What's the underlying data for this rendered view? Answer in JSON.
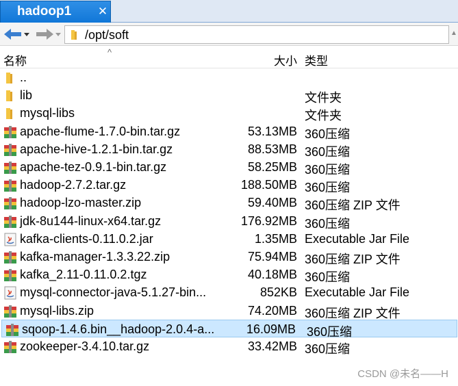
{
  "tab": {
    "title": "hadoop1",
    "close": "✕"
  },
  "address": {
    "path": "/opt/soft"
  },
  "header": {
    "name": "名称",
    "size": "大小",
    "type": "类型"
  },
  "files": [
    {
      "name": "..",
      "size": "",
      "type": "",
      "icon": "folder-icon"
    },
    {
      "name": "lib",
      "size": "",
      "type": "文件夹",
      "icon": "folder-icon"
    },
    {
      "name": "mysql-libs",
      "size": "",
      "type": "文件夹",
      "icon": "folder-icon"
    },
    {
      "name": "apache-flume-1.7.0-bin.tar.gz",
      "size": "53.13MB",
      "type": "360压缩",
      "icon": "archive-icon"
    },
    {
      "name": "apache-hive-1.2.1-bin.tar.gz",
      "size": "88.53MB",
      "type": "360压缩",
      "icon": "archive-icon"
    },
    {
      "name": "apache-tez-0.9.1-bin.tar.gz",
      "size": "58.25MB",
      "type": "360压缩",
      "icon": "archive-icon"
    },
    {
      "name": "hadoop-2.7.2.tar.gz",
      "size": "188.50MB",
      "type": "360压缩",
      "icon": "archive-icon"
    },
    {
      "name": "hadoop-lzo-master.zip",
      "size": "59.40MB",
      "type": "360压缩 ZIP 文件",
      "icon": "archive-icon"
    },
    {
      "name": "jdk-8u144-linux-x64.tar.gz",
      "size": "176.92MB",
      "type": "360压缩",
      "icon": "archive-icon"
    },
    {
      "name": "kafka-clients-0.11.0.2.jar",
      "size": "1.35MB",
      "type": "Executable Jar File",
      "icon": "jar-icon"
    },
    {
      "name": "kafka-manager-1.3.3.22.zip",
      "size": "75.94MB",
      "type": "360压缩 ZIP 文件",
      "icon": "archive-icon"
    },
    {
      "name": "kafka_2.11-0.11.0.2.tgz",
      "size": "40.18MB",
      "type": "360压缩",
      "icon": "archive-icon"
    },
    {
      "name": "mysql-connector-java-5.1.27-bin...",
      "size": "852KB",
      "type": "Executable Jar File",
      "icon": "jar-icon"
    },
    {
      "name": "mysql-libs.zip",
      "size": "74.20MB",
      "type": "360压缩 ZIP 文件",
      "icon": "archive-icon"
    },
    {
      "name": "sqoop-1.4.6.bin__hadoop-2.0.4-a...",
      "size": "16.09MB",
      "type": "360压缩",
      "icon": "archive-icon",
      "selected": true
    },
    {
      "name": "zookeeper-3.4.10.tar.gz",
      "size": "33.42MB",
      "type": "360压缩",
      "icon": "archive-icon"
    }
  ],
  "watermark": "CSDN @未名——H",
  "colors": {
    "tab": "#1177d8",
    "selection": "#cce8ff",
    "folder": "#f4c542"
  }
}
